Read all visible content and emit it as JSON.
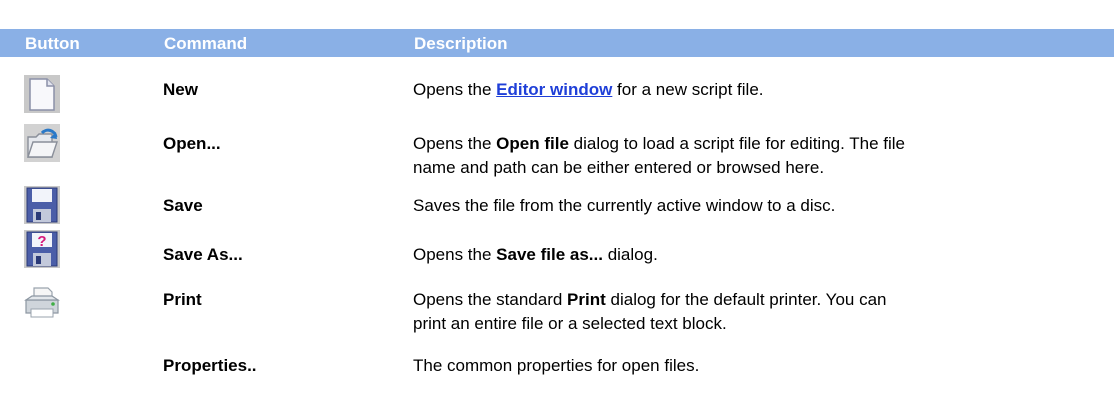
{
  "header": {
    "button": "Button",
    "command": "Command",
    "description": "Description"
  },
  "rows": [
    {
      "icon": "new-document-icon",
      "command": "New",
      "desc": {
        "pre": "Opens the ",
        "link": "Editor window",
        "post": " for a new script file."
      }
    },
    {
      "icon": "open-folder-icon",
      "command": "Open...",
      "desc": {
        "pre": "Opens the ",
        "bold": "Open file",
        "post": " dialog to load a script file for editing. The file",
        "line2": "name and path can be either entered or browsed here."
      }
    },
    {
      "icon": "save-disk-icon",
      "command": "Save",
      "desc": {
        "text": "Saves the file from the currently active window to a disc."
      }
    },
    {
      "icon": "save-as-disk-icon",
      "command": "Save As...",
      "desc": {
        "pre": "Opens the ",
        "bold": "Save file as...",
        "post": " dialog."
      }
    },
    {
      "icon": "printer-icon",
      "command": "Print",
      "desc": {
        "pre": "Opens the standard ",
        "bold": "Print",
        "post": " dialog for the default printer. You can",
        "line2": "print an entire file or a selected text block."
      }
    },
    {
      "icon": "",
      "command": "Properties..",
      "desc": {
        "text": "The common properties for open files."
      }
    }
  ]
}
